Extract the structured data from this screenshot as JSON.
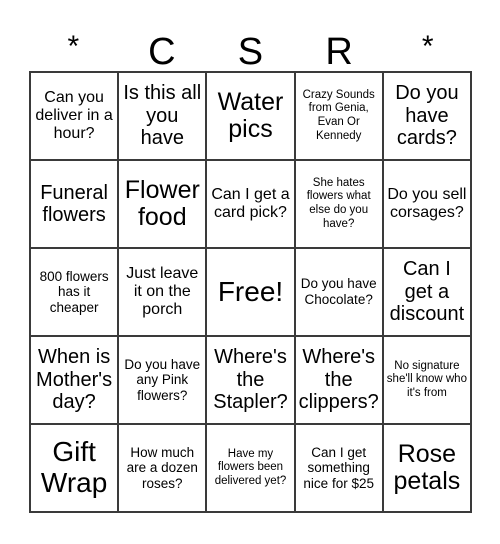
{
  "card": {
    "header": {
      "letters": [
        "*",
        "C",
        "S",
        "R",
        "*"
      ]
    },
    "rows": [
      [
        {
          "text": "Can you deliver in a hour?",
          "size": "sz-m"
        },
        {
          "text": "Is this all you have",
          "size": "sz-l"
        },
        {
          "text": "Water pics",
          "size": "sz-xl"
        },
        {
          "text": "Crazy Sounds from Genia, Evan Or Kennedy",
          "size": "sz-xs"
        },
        {
          "text": "Do you have cards?",
          "size": "sz-l"
        }
      ],
      [
        {
          "text": "Funeral flowers",
          "size": "sz-l"
        },
        {
          "text": "Flower food",
          "size": "sz-xl"
        },
        {
          "text": "Can I get a card pick?",
          "size": "sz-m"
        },
        {
          "text": "She hates flowers what else do you have?",
          "size": "sz-xs"
        },
        {
          "text": "Do you sell corsages?",
          "size": "sz-m"
        }
      ],
      [
        {
          "text": "800 flowers has it cheaper",
          "size": "sz-s"
        },
        {
          "text": "Just leave it on the porch",
          "size": "sz-m"
        },
        {
          "text": "Free!",
          "size": "sz-xxl"
        },
        {
          "text": "Do you have Chocolate?",
          "size": "sz-s"
        },
        {
          "text": "Can I get a discount",
          "size": "sz-l"
        }
      ],
      [
        {
          "text": "When is Mother's day?",
          "size": "sz-l"
        },
        {
          "text": "Do you have any Pink flowers?",
          "size": "sz-s"
        },
        {
          "text": "Where's the Stapler?",
          "size": "sz-l"
        },
        {
          "text": "Where's the clippers?",
          "size": "sz-l"
        },
        {
          "text": "No signature she'll know who it's from",
          "size": "sz-xs"
        }
      ],
      [
        {
          "text": "Gift Wrap",
          "size": "sz-xxl"
        },
        {
          "text": "How much are a dozen roses?",
          "size": "sz-s"
        },
        {
          "text": "Have my flowers been delivered yet?",
          "size": "sz-xs"
        },
        {
          "text": "Can I get something nice for $25",
          "size": "sz-s"
        },
        {
          "text": "Rose petals",
          "size": "sz-xl"
        }
      ]
    ]
  },
  "colors": {
    "background": "#ffffff",
    "grid_line": "#3a3a3a",
    "text": "#000000"
  }
}
